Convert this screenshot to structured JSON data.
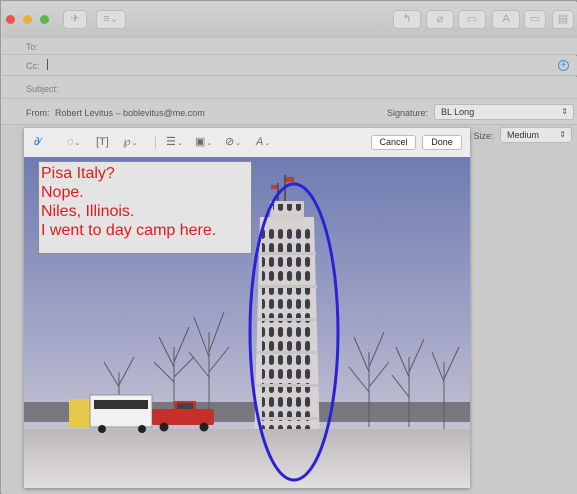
{
  "window": {
    "toolbar_icons": [
      "send-icon",
      "format-list-icon",
      "reply-icon",
      "attach-icon",
      "photo-icon",
      "text-format-icon",
      "window-icon",
      "template-icon"
    ],
    "text_format_label": "A"
  },
  "header": {
    "to_label": "To:",
    "cc_label": "Cc:",
    "subject_label": "Subject:",
    "from_label": "From:",
    "from_value": "Robert Levitus – boblevitus@me.com",
    "signature_label": "Signature:",
    "signature_value": "BL Long",
    "image_size_label": "e Size:",
    "image_size_value": "Medium"
  },
  "markup": {
    "cancel_label": "Cancel",
    "done_label": "Done",
    "tools": [
      "sketch-icon",
      "shapes-icon",
      "text-icon",
      "signature-icon",
      "line-style-icon",
      "border-color-icon",
      "fill-color-icon",
      "text-style-icon"
    ],
    "annotation_color": "#e3191c",
    "oval_color": "#2b22d8"
  },
  "note": {
    "lines": [
      "Pisa Italy?",
      "Nope.",
      "Niles, Illinois.",
      "I went to day camp here."
    ]
  }
}
